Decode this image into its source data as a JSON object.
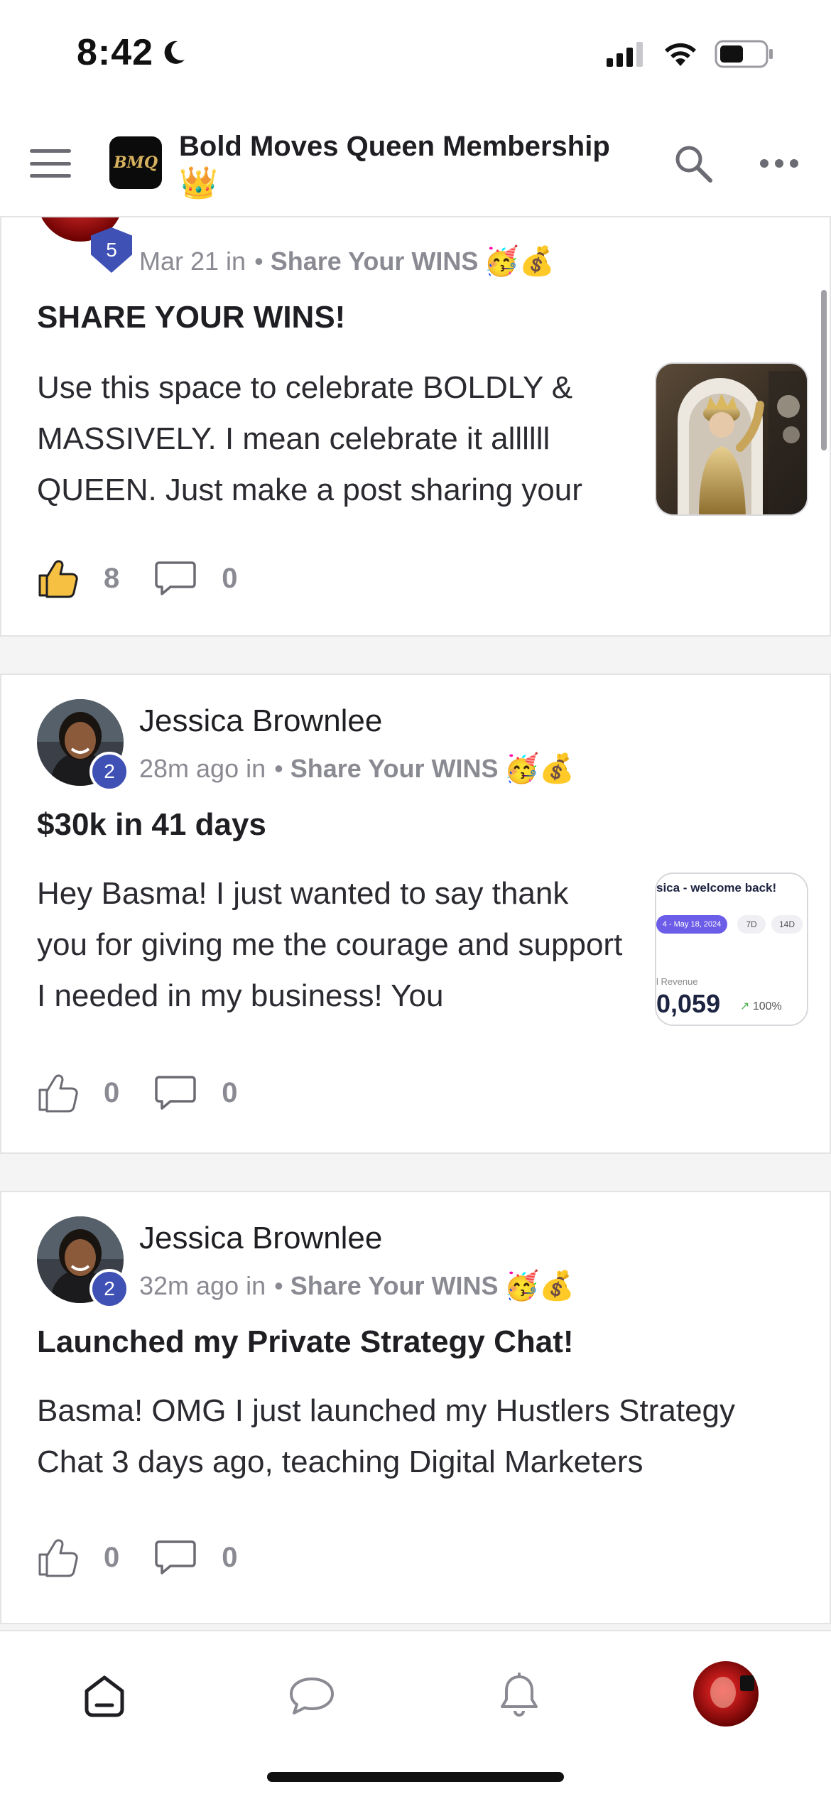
{
  "status_bar": {
    "time": "8:42"
  },
  "header": {
    "logo_text": "BMQ",
    "title": "Bold Moves Queen Membership",
    "title_emoji": "👑"
  },
  "posts": [
    {
      "author": "",
      "level": "5",
      "meta_time": "Mar 21 in",
      "space": "Share Your WINS",
      "space_emoji": "🥳💰",
      "title": "SHARE YOUR WINS!",
      "body": "Use this space to celebrate BOLDLY & MASSIVELY. I mean celebrate it allllll QUEEN. Just make a post sharing your",
      "likes": "8",
      "comments": "0",
      "liked": true
    },
    {
      "author": "Jessica Brownlee",
      "level": "2",
      "meta_time": "28m ago in",
      "space": "Share Your WINS",
      "space_emoji": "🥳💰",
      "title": "$30k in 41 days",
      "body": "Hey Basma! I just wanted to say thank you for giving me the courage and support I needed in my business! You",
      "likes": "0",
      "comments": "0",
      "liked": false,
      "thumb": {
        "greeting": "sica - welcome back!",
        "date_range": "4 - May 18, 2024",
        "tab_7d": "7D",
        "tab_14d": "14D",
        "revenue_label": "l Revenue",
        "revenue_value": "0,059",
        "change": "100%"
      }
    },
    {
      "author": "Jessica Brownlee",
      "level": "2",
      "meta_time": "32m ago in",
      "space": "Share Your WINS",
      "space_emoji": "🥳💰",
      "title": "Launched my Private Strategy Chat!",
      "body": "Basma! OMG I just launched my Hustlers Strategy Chat 3 days ago, teaching Digital Marketers",
      "likes": "0",
      "comments": "0",
      "liked": false
    }
  ],
  "bottom_nav": {
    "items": [
      "home-icon",
      "chat-icon",
      "bell-icon",
      "profile-avatar"
    ]
  },
  "colors": {
    "accent": "#3f51b5",
    "muted": "#8a8a93",
    "like_fill": "#f6c142"
  }
}
